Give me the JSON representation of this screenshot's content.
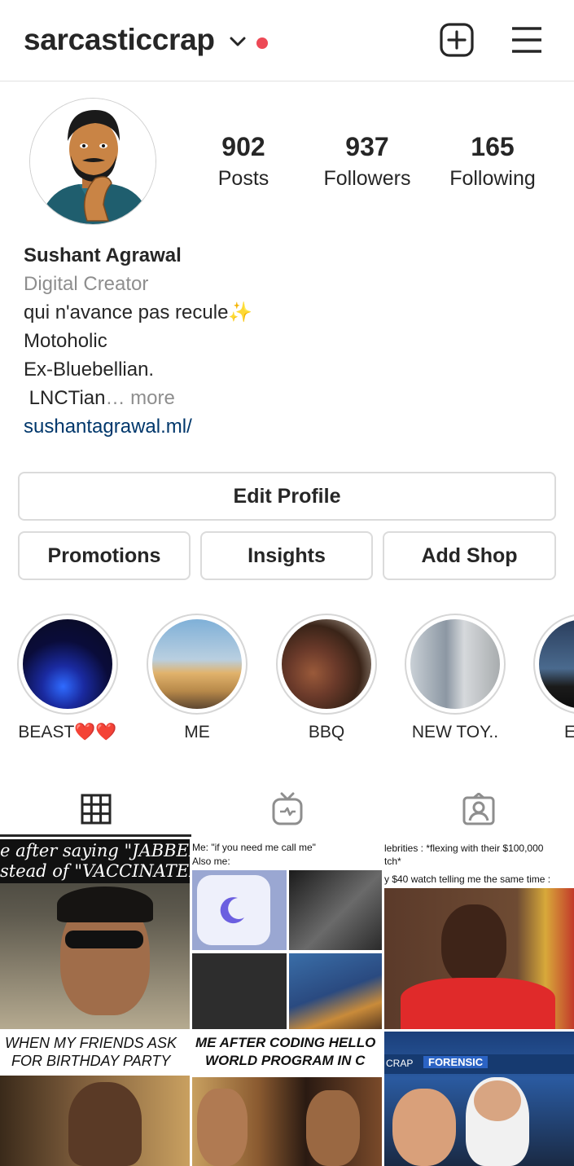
{
  "header": {
    "username": "sarcasticcrap",
    "icons": [
      "chevron-down-icon",
      "notification-dot",
      "new-post-icon",
      "menu-icon"
    ],
    "accent_dot_color": "#ed4956"
  },
  "profile": {
    "stats": [
      {
        "value": "902",
        "label": "Posts"
      },
      {
        "value": "937",
        "label": "Followers"
      },
      {
        "value": "165",
        "label": "Following"
      }
    ],
    "name": "Sushant Agrawal",
    "category": "Digital Creator",
    "bio_line1": "qui n'avance pas recule✨",
    "bio_line2": "Motoholic",
    "bio_line3": "Ex-Bluebellian.",
    "bio_line4": " LNCTian",
    "bio_more": "… more",
    "link": "sushantagrawal.ml/",
    "link_color": "#00376b"
  },
  "buttons": {
    "edit_profile": "Edit Profile",
    "promotions": "Promotions",
    "insights": "Insights",
    "add_shop": "Add Shop"
  },
  "highlights": [
    {
      "label": "BEAST❤️❤️"
    },
    {
      "label": "ME"
    },
    {
      "label": "BBQ"
    },
    {
      "label": "NEW TOY.."
    },
    {
      "label": "E"
    }
  ],
  "tabs": [
    "grid-icon",
    "igtv-icon",
    "tagged-icon"
  ],
  "posts": [
    {
      "caption_line1": "e after saying \"JABBED\"",
      "caption_line2": "stead of \"VACCINATED\""
    },
    {
      "caption_line1": "Me: \"if you need me call me\"",
      "caption_line2": "Also me:"
    },
    {
      "caption_line1": "lebrities : *flexing with their $100,000",
      "caption_line2": "tch*",
      "caption_line3": "y $40 watch telling me the same time :"
    },
    {
      "caption_line1": "WHEN MY FRIENDS ASK",
      "caption_line2": "FOR BIRTHDAY PARTY"
    },
    {
      "caption_line1": "ME AFTER CODING HELLO",
      "caption_line2": "WORLD PROGRAM IN C"
    },
    {
      "caption_line1": "CRAP",
      "caption_line2": "FORENSIC"
    }
  ]
}
